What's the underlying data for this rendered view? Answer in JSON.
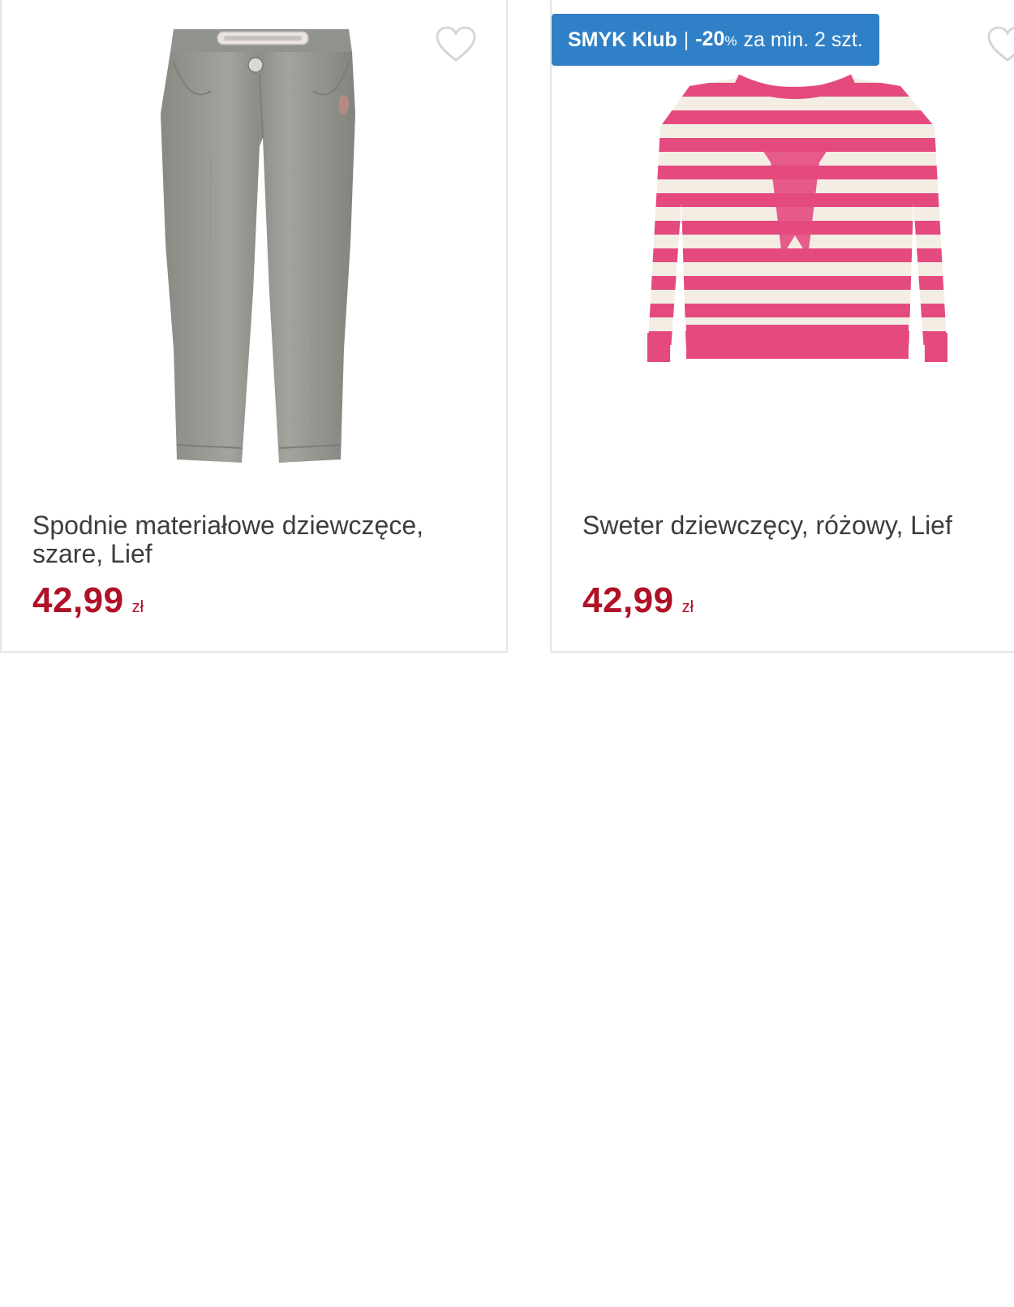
{
  "products": [
    {
      "name": "Spodnie materiałowe dziewczęce, szare, Lief",
      "price": "42,99",
      "currency": "zł",
      "image_icon": "gray-girls-pants-icon",
      "favorite_icon": "heart-outline-icon"
    },
    {
      "name": "Sweter dziewczęcy, różowy, Lief",
      "price": "42,99",
      "currency": "zł",
      "image_icon": "pink-striped-sweater-icon",
      "favorite_icon": "heart-outline-icon",
      "badge": {
        "brand": "SMYK Klub",
        "separator": "|",
        "discount": "-20",
        "percent_sign": "%",
        "condition": "za min. 2 szt."
      }
    }
  ],
  "colors": {
    "price": "#b01126",
    "badge_bg": "#2f80c6",
    "pants": "#8e938b",
    "sweater_pink": "#e44a7e",
    "sweater_cream": "#f3ede4"
  }
}
